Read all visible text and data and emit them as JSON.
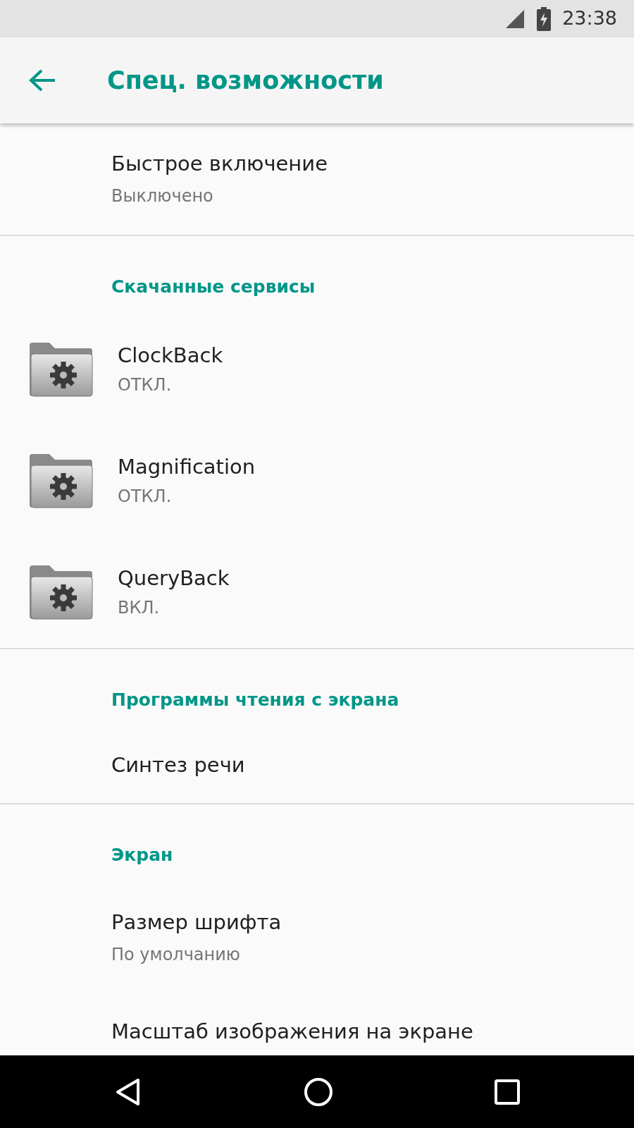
{
  "status_bar": {
    "time": "23:38"
  },
  "app_bar": {
    "title": "Спец. возможности"
  },
  "sections": [
    {
      "items": [
        {
          "kind": "text",
          "title": "Быстрое включение",
          "subtitle": "Выключено"
        }
      ]
    },
    {
      "header": "Скачанные сервисы",
      "items": [
        {
          "kind": "service",
          "title": "ClockBack",
          "subtitle": "ОТКЛ."
        },
        {
          "kind": "service",
          "title": "Magnification",
          "subtitle": "ОТКЛ."
        },
        {
          "kind": "service",
          "title": "QueryBack",
          "subtitle": "ВКЛ."
        }
      ]
    },
    {
      "header": "Программы чтения с экрана",
      "items": [
        {
          "kind": "text",
          "title": "Синтез речи"
        }
      ]
    },
    {
      "header": "Экран",
      "items": [
        {
          "kind": "text",
          "title": "Размер шрифта",
          "subtitle": "По умолчанию"
        },
        {
          "kind": "text",
          "title": "Масштаб изображения на экране"
        }
      ]
    }
  ]
}
